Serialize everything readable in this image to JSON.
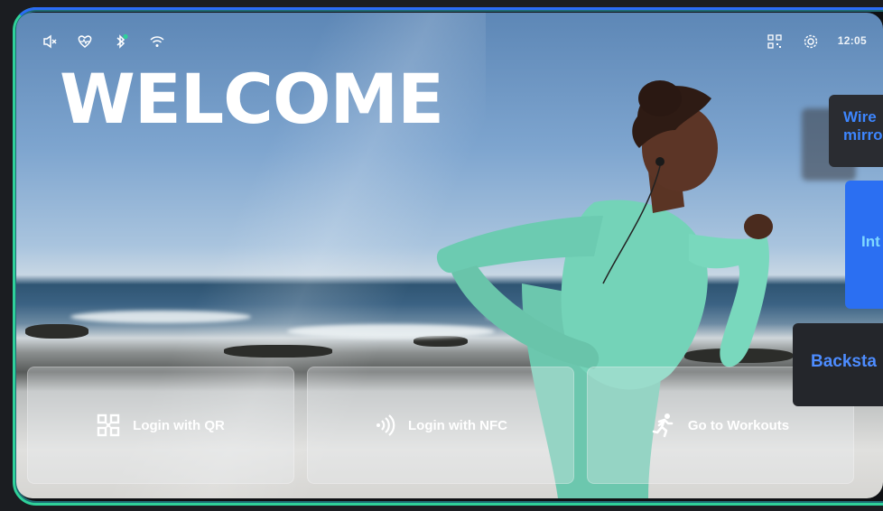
{
  "status_bar": {
    "time": "12:05",
    "left_icons": [
      "speaker-mute-icon",
      "heart-rate-icon",
      "bluetooth-icon",
      "wifi-icon"
    ],
    "right_icons": [
      "qr-code-icon",
      "gear-icon"
    ],
    "bluetooth_status_color": "#2fd19a"
  },
  "hero": {
    "title": "WELCOME"
  },
  "actions": [
    {
      "label": "Login with QR",
      "icon": "qr-code-icon"
    },
    {
      "label": "Login with NFC",
      "icon": "nfc-icon"
    },
    {
      "label": "Go to Workouts",
      "icon": "running-person-icon"
    }
  ],
  "side_panels": [
    {
      "label_line1": "Wire",
      "label_line2": "mirro"
    },
    {
      "label": "Int"
    },
    {
      "label": "Backsta"
    }
  ],
  "colors": {
    "frame_accent_green": "#2fd19a",
    "frame_accent_blue": "#2b6cf6",
    "panel_blue": "#2b6ff2"
  }
}
